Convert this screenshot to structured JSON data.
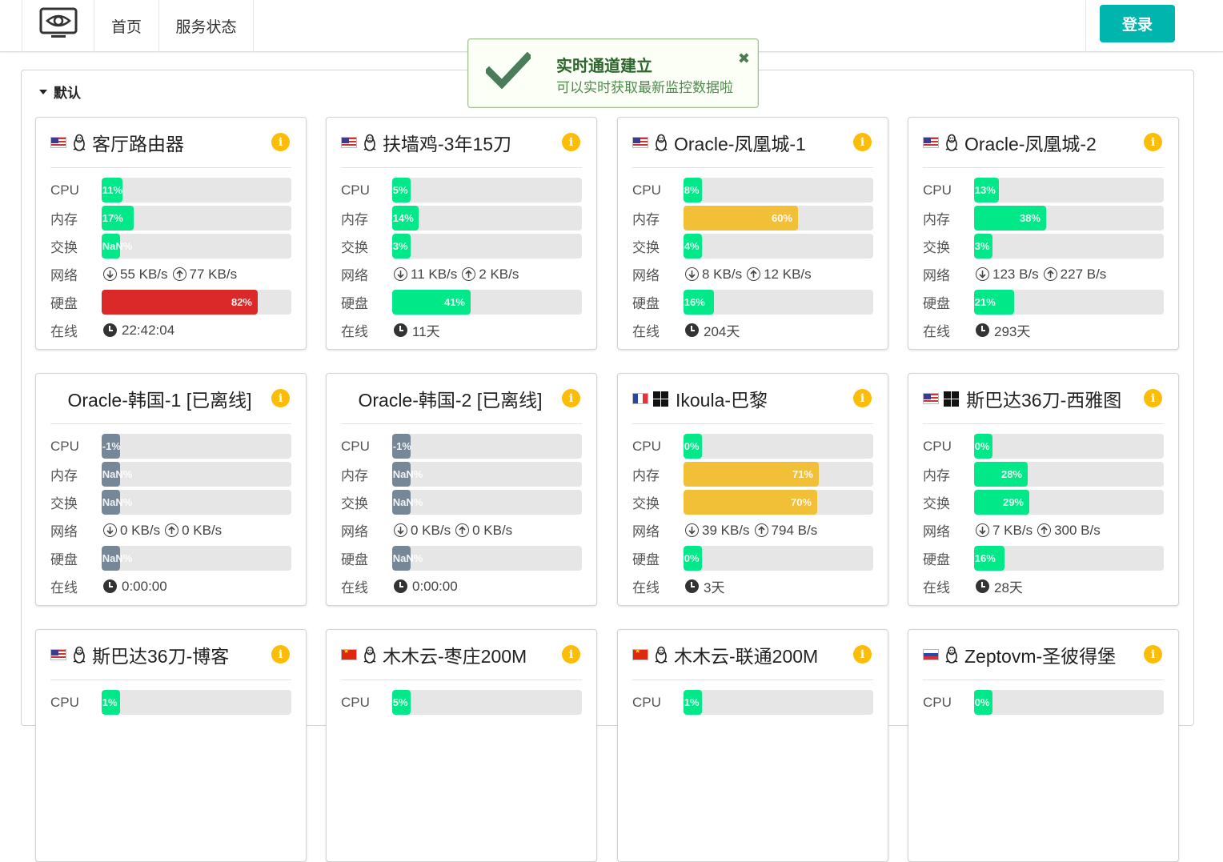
{
  "nav": {
    "logo_icon": "eye-monitor-icon",
    "home": "首页",
    "status": "服务状态",
    "login": "登录"
  },
  "toast": {
    "title": "实时通道建立",
    "message": "可以实时获取最新监控数据啦",
    "icon": "checkmark-icon",
    "close": "✖"
  },
  "group": {
    "name": "默认"
  },
  "labels": {
    "cpu": "CPU",
    "mem": "内存",
    "swap": "交换",
    "net": "网络",
    "disk": "硬盘",
    "uptime": "在线"
  },
  "colors": {
    "accent": "#00b5ad",
    "ok": "#00e887",
    "warn": "#f2c037",
    "danger": "#db2828",
    "offline": "#768898"
  },
  "servers": [
    {
      "name": "客厅路由器",
      "flag": "us",
      "os": "linux",
      "offline": false,
      "cpu": {
        "text": "11%",
        "pct": 11,
        "color": "green"
      },
      "mem": {
        "text": "17%",
        "pct": 17,
        "color": "green"
      },
      "swap": {
        "text": "NaN%",
        "pct": 9,
        "color": "green"
      },
      "net_in": "55 KB/s",
      "net_out": "77 KB/s",
      "disk": {
        "text": "82%",
        "pct": 82,
        "color": "red"
      },
      "uptime": "22:42:04"
    },
    {
      "name": "扶墙鸡-3年15刀",
      "flag": "us",
      "os": "linux",
      "offline": false,
      "cpu": {
        "text": "5%",
        "pct": 5,
        "color": "green"
      },
      "mem": {
        "text": "14%",
        "pct": 14,
        "color": "green"
      },
      "swap": {
        "text": "3%",
        "pct": 3,
        "color": "green"
      },
      "net_in": "11 KB/s",
      "net_out": "2 KB/s",
      "disk": {
        "text": "41%",
        "pct": 41,
        "color": "green"
      },
      "uptime": "11天"
    },
    {
      "name": "Oracle-凤凰城-1",
      "flag": "us",
      "os": "linux",
      "offline": false,
      "cpu": {
        "text": "8%",
        "pct": 8,
        "color": "green"
      },
      "mem": {
        "text": "60%",
        "pct": 60,
        "color": "yellow"
      },
      "swap": {
        "text": "4%",
        "pct": 4,
        "color": "green"
      },
      "net_in": "8 KB/s",
      "net_out": "12 KB/s",
      "disk": {
        "text": "16%",
        "pct": 16,
        "color": "green"
      },
      "uptime": "204天"
    },
    {
      "name": "Oracle-凤凰城-2",
      "flag": "us",
      "os": "linux",
      "offline": false,
      "cpu": {
        "text": "13%",
        "pct": 13,
        "color": "green"
      },
      "mem": {
        "text": "38%",
        "pct": 38,
        "color": "green"
      },
      "swap": {
        "text": "3%",
        "pct": 3,
        "color": "green"
      },
      "net_in": "123 B/s",
      "net_out": "227 B/s",
      "disk": {
        "text": "21%",
        "pct": 21,
        "color": "green"
      },
      "uptime": "293天"
    },
    {
      "name": "Oracle-韩国-1 [已离线]",
      "flag": "",
      "os": "",
      "offline": true,
      "cpu": {
        "text": "-1%",
        "pct": 9,
        "color": "grey"
      },
      "mem": {
        "text": "NaN%",
        "pct": 9,
        "color": "grey"
      },
      "swap": {
        "text": "NaN%",
        "pct": 9,
        "color": "grey"
      },
      "net_in": "0 KB/s",
      "net_out": "0 KB/s",
      "disk": {
        "text": "NaN%",
        "pct": 9,
        "color": "grey"
      },
      "uptime": "0:00:00"
    },
    {
      "name": "Oracle-韩国-2 [已离线]",
      "flag": "",
      "os": "",
      "offline": true,
      "cpu": {
        "text": "-1%",
        "pct": 9,
        "color": "grey"
      },
      "mem": {
        "text": "NaN%",
        "pct": 9,
        "color": "grey"
      },
      "swap": {
        "text": "NaN%",
        "pct": 9,
        "color": "grey"
      },
      "net_in": "0 KB/s",
      "net_out": "0 KB/s",
      "disk": {
        "text": "NaN%",
        "pct": 9,
        "color": "grey"
      },
      "uptime": "0:00:00"
    },
    {
      "name": "Ikoula-巴黎",
      "flag": "fr",
      "os": "windows",
      "offline": false,
      "cpu": {
        "text": "0%",
        "pct": 0,
        "color": "green"
      },
      "mem": {
        "text": "71%",
        "pct": 71,
        "color": "yellow"
      },
      "swap": {
        "text": "70%",
        "pct": 70,
        "color": "yellow"
      },
      "net_in": "39 KB/s",
      "net_out": "794 B/s",
      "disk": {
        "text": "0%",
        "pct": 0,
        "color": "green"
      },
      "uptime": "3天"
    },
    {
      "name": "斯巴达36刀-西雅图",
      "flag": "us",
      "os": "windows",
      "offline": false,
      "cpu": {
        "text": "0%",
        "pct": 0,
        "color": "green"
      },
      "mem": {
        "text": "28%",
        "pct": 28,
        "color": "green"
      },
      "swap": {
        "text": "29%",
        "pct": 29,
        "color": "green"
      },
      "net_in": "7 KB/s",
      "net_out": "300 B/s",
      "disk": {
        "text": "16%",
        "pct": 16,
        "color": "green"
      },
      "uptime": "28天"
    },
    {
      "name": "斯巴达36刀-博客",
      "flag": "us",
      "os": "linux",
      "offline": false,
      "cpu": {
        "text": "1%",
        "pct": 1,
        "color": "green"
      }
    },
    {
      "name": "木木云-枣庄200M",
      "flag": "cn",
      "os": "linux",
      "offline": false,
      "cpu": {
        "text": "5%",
        "pct": 5,
        "color": "green"
      }
    },
    {
      "name": "木木云-联通200M",
      "flag": "cn",
      "os": "linux",
      "offline": false,
      "cpu": {
        "text": "1%",
        "pct": 1,
        "color": "green"
      }
    },
    {
      "name": "Zeptovm-圣彼得堡",
      "flag": "ru",
      "os": "linux",
      "offline": false,
      "cpu": {
        "text": "0%",
        "pct": 0,
        "color": "green"
      }
    }
  ]
}
